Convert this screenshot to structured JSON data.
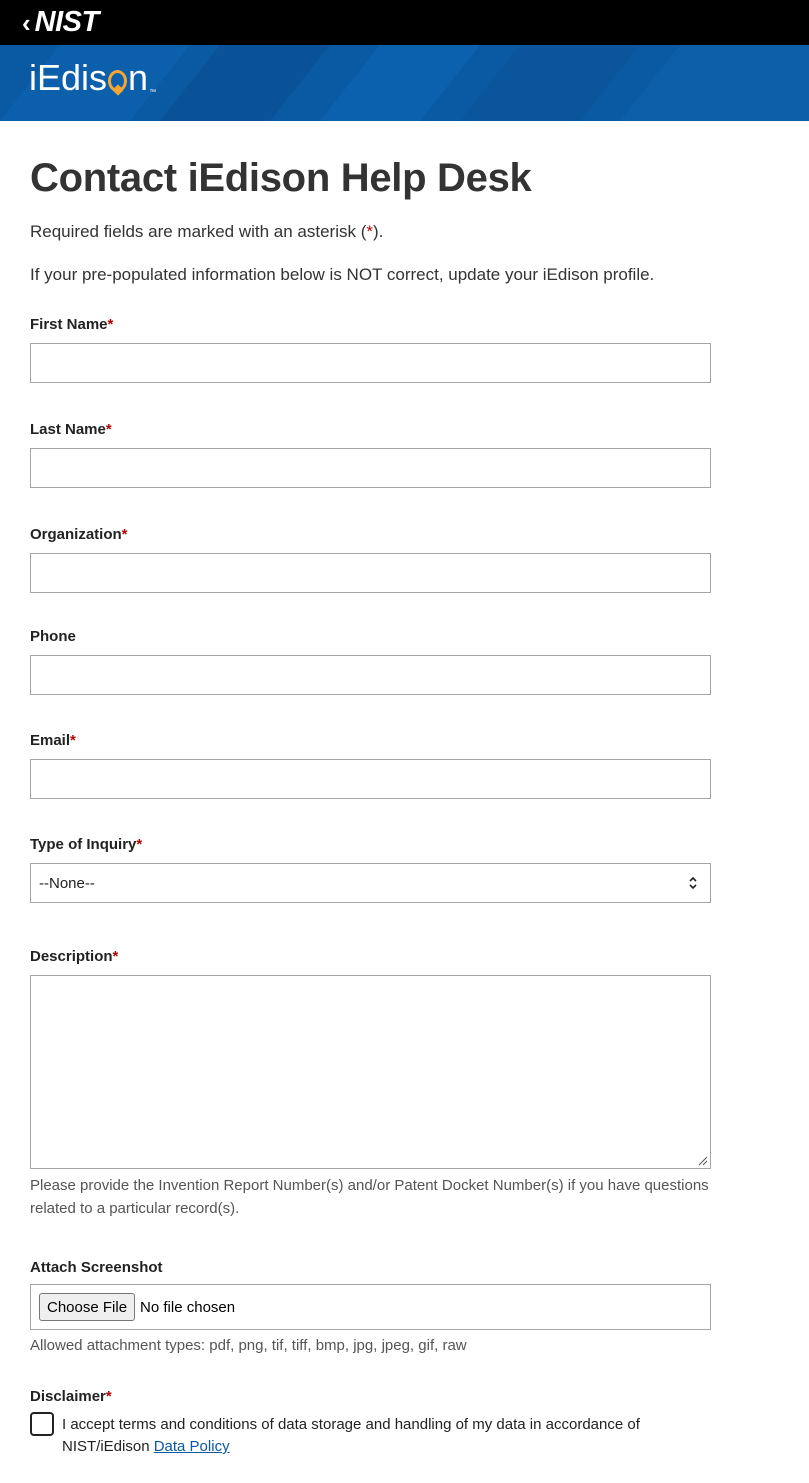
{
  "header": {
    "back_chevron": "‹",
    "nist_logo": "NIST",
    "brand_prefix": "iEdis",
    "brand_suffix": "n",
    "brand_tm": "™",
    "brand_color": "#0a5aa3",
    "accent_color": "#f4a533"
  },
  "page": {
    "title": "Contact iEdison Help Desk",
    "required_note_pre": "Required fields are marked with an asterisk (",
    "required_note_mark": "*",
    "required_note_post": ").",
    "profile_note": "If your pre-populated information below is NOT correct, update your iEdison profile."
  },
  "form": {
    "required_mark": "*",
    "first_name": {
      "label": "First Name",
      "value": ""
    },
    "last_name": {
      "label": "Last Name",
      "value": ""
    },
    "organization": {
      "label": "Organization",
      "value": ""
    },
    "phone": {
      "label": "Phone",
      "value": ""
    },
    "email": {
      "label": "Email",
      "value": ""
    },
    "inquiry_type": {
      "label": "Type of Inquiry",
      "selected": "--None--"
    },
    "description": {
      "label": "Description",
      "value": "",
      "help": "Please provide the Invention Report Number(s) and/or Patent Docket Number(s) if you have questions related to a particular record(s)."
    },
    "attachment": {
      "label": "Attach Screenshot",
      "button_label": "Choose File",
      "status": "No file chosen",
      "help": "Allowed attachment types: pdf, png, tif, tiff, bmp, jpg, jpeg, gif, raw"
    },
    "disclaimer": {
      "label": "Disclaimer",
      "checked": false,
      "text": "I accept terms and conditions of data storage and handling of my data in accordance of NIST/iEdison ",
      "link_label": "Data Policy"
    }
  }
}
